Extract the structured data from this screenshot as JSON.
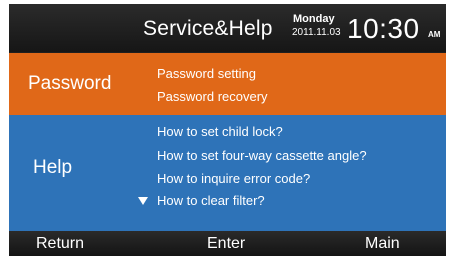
{
  "header": {
    "title": "Service&Help",
    "day": "Monday",
    "date": "2011.11.03",
    "time": "10:30",
    "ampm": "AM"
  },
  "sections": {
    "password": {
      "label": "Password",
      "color": "#e06818",
      "items": [
        "Password setting",
        "Password recovery"
      ]
    },
    "help": {
      "label": "Help",
      "color": "#2e73b8",
      "items": [
        "How to set child lock?",
        "How to set four-way cassette angle?",
        "How to inquire error code?",
        "How to clear filter?"
      ],
      "cursor_icon": "triangle-down-icon"
    }
  },
  "footer": {
    "return_label": "Return",
    "enter_label": "Enter",
    "main_label": "Main"
  }
}
